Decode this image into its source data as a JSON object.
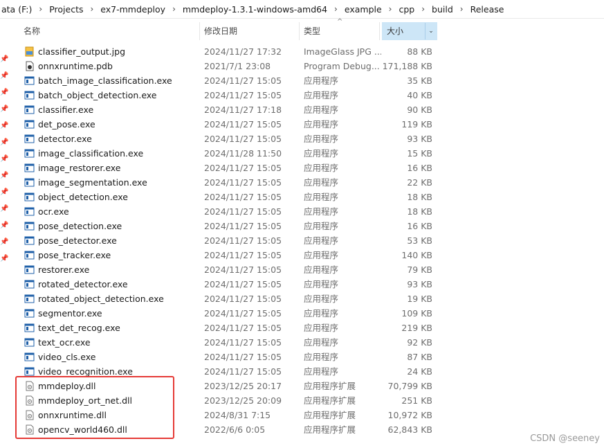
{
  "breadcrumb": [
    "ata (F:)",
    "Projects",
    "ex7-mmdeploy",
    "mmdeploy-1.3.1-windows-amd64",
    "example",
    "cpp",
    "build",
    "Release"
  ],
  "columns": {
    "name": "名称",
    "modified": "修改日期",
    "type": "类型",
    "size": "大小"
  },
  "files": [
    {
      "name": "classifier_output.jpg",
      "date": "2024/11/27 17:32",
      "type": "ImageGlass JPG ...",
      "size": "88 KB",
      "icon": "jpg-file-icon"
    },
    {
      "name": "onnxruntime.pdb",
      "date": "2021/7/1 23:08",
      "type": "Program Debug...",
      "size": "171,188 KB",
      "icon": "pdb-file-icon"
    },
    {
      "name": "batch_image_classification.exe",
      "date": "2024/11/27 15:05",
      "type": "应用程序",
      "size": "35 KB",
      "icon": "exe-file-icon"
    },
    {
      "name": "batch_object_detection.exe",
      "date": "2024/11/27 15:05",
      "type": "应用程序",
      "size": "40 KB",
      "icon": "exe-file-icon"
    },
    {
      "name": "classifier.exe",
      "date": "2024/11/27 17:18",
      "type": "应用程序",
      "size": "90 KB",
      "icon": "exe-file-icon"
    },
    {
      "name": "det_pose.exe",
      "date": "2024/11/27 15:05",
      "type": "应用程序",
      "size": "119 KB",
      "icon": "exe-file-icon"
    },
    {
      "name": "detector.exe",
      "date": "2024/11/27 15:05",
      "type": "应用程序",
      "size": "93 KB",
      "icon": "exe-file-icon"
    },
    {
      "name": "image_classification.exe",
      "date": "2024/11/28 11:50",
      "type": "应用程序",
      "size": "15 KB",
      "icon": "exe-file-icon"
    },
    {
      "name": "image_restorer.exe",
      "date": "2024/11/27 15:05",
      "type": "应用程序",
      "size": "16 KB",
      "icon": "exe-file-icon"
    },
    {
      "name": "image_segmentation.exe",
      "date": "2024/11/27 15:05",
      "type": "应用程序",
      "size": "22 KB",
      "icon": "exe-file-icon"
    },
    {
      "name": "object_detection.exe",
      "date": "2024/11/27 15:05",
      "type": "应用程序",
      "size": "18 KB",
      "icon": "exe-file-icon"
    },
    {
      "name": "ocr.exe",
      "date": "2024/11/27 15:05",
      "type": "应用程序",
      "size": "18 KB",
      "icon": "exe-file-icon"
    },
    {
      "name": "pose_detection.exe",
      "date": "2024/11/27 15:05",
      "type": "应用程序",
      "size": "16 KB",
      "icon": "exe-file-icon"
    },
    {
      "name": "pose_detector.exe",
      "date": "2024/11/27 15:05",
      "type": "应用程序",
      "size": "53 KB",
      "icon": "exe-file-icon"
    },
    {
      "name": "pose_tracker.exe",
      "date": "2024/11/27 15:05",
      "type": "应用程序",
      "size": "140 KB",
      "icon": "exe-file-icon"
    },
    {
      "name": "restorer.exe",
      "date": "2024/11/27 15:05",
      "type": "应用程序",
      "size": "79 KB",
      "icon": "exe-file-icon"
    },
    {
      "name": "rotated_detector.exe",
      "date": "2024/11/27 15:05",
      "type": "应用程序",
      "size": "93 KB",
      "icon": "exe-file-icon"
    },
    {
      "name": "rotated_object_detection.exe",
      "date": "2024/11/27 15:05",
      "type": "应用程序",
      "size": "19 KB",
      "icon": "exe-file-icon"
    },
    {
      "name": "segmentor.exe",
      "date": "2024/11/27 15:05",
      "type": "应用程序",
      "size": "109 KB",
      "icon": "exe-file-icon"
    },
    {
      "name": "text_det_recog.exe",
      "date": "2024/11/27 15:05",
      "type": "应用程序",
      "size": "219 KB",
      "icon": "exe-file-icon"
    },
    {
      "name": "text_ocr.exe",
      "date": "2024/11/27 15:05",
      "type": "应用程序",
      "size": "92 KB",
      "icon": "exe-file-icon"
    },
    {
      "name": "video_cls.exe",
      "date": "2024/11/27 15:05",
      "type": "应用程序",
      "size": "87 KB",
      "icon": "exe-file-icon"
    },
    {
      "name": "video_recognition.exe",
      "date": "2024/11/27 15:05",
      "type": "应用程序",
      "size": "24 KB",
      "icon": "exe-file-icon"
    },
    {
      "name": "mmdeploy.dll",
      "date": "2023/12/25 20:17",
      "type": "应用程序扩展",
      "size": "70,799 KB",
      "icon": "dll-file-icon"
    },
    {
      "name": "mmdeploy_ort_net.dll",
      "date": "2023/12/25 20:09",
      "type": "应用程序扩展",
      "size": "251 KB",
      "icon": "dll-file-icon"
    },
    {
      "name": "onnxruntime.dll",
      "date": "2024/8/31 7:15",
      "type": "应用程序扩展",
      "size": "10,972 KB",
      "icon": "dll-file-icon"
    },
    {
      "name": "opencv_world460.dll",
      "date": "2022/6/6 0:05",
      "type": "应用程序扩展",
      "size": "62,843 KB",
      "icon": "dll-file-icon"
    }
  ],
  "watermark": "CSDN @seeney",
  "colors": {
    "highlight": "#e53935",
    "size_header_bg": "#cde6f7",
    "exe_icon": "#1e5fa8"
  }
}
